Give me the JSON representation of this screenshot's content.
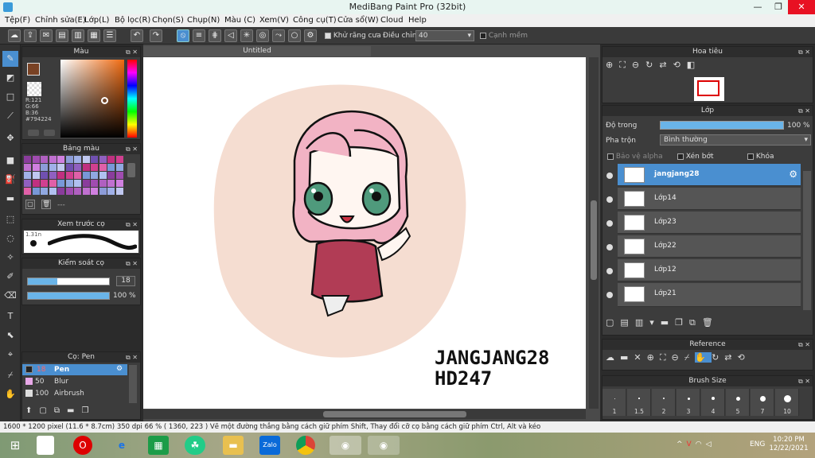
{
  "app": {
    "title": "MediBang Paint Pro (32bit)"
  },
  "menu": [
    "Tệp(F)",
    "Chỉnh sửa(E)",
    "Lớp(L)",
    "Bộ lọc(R)",
    "Chọn(S)",
    "Chụp(N)",
    "Màu (C)",
    "Xem(V)",
    "Công cụ(T)",
    "Cửa sổ(W)",
    "Cloud",
    "Help"
  ],
  "toolbar": {
    "antialias_label": "Khử răng cưa",
    "correction_label": "Điều chỉnh",
    "correction_value": "40",
    "smooth_label": "Cạnh mềm"
  },
  "color_panel": {
    "title": "Màu",
    "r": "R:121",
    "g": "G:66",
    "b": "B:36",
    "hex": "#794224"
  },
  "palette_panel": {
    "title": "Bảng màu",
    "extra": "---"
  },
  "brush_preview": {
    "title": "Xem trước cọ",
    "size": "1.31n"
  },
  "brush_control": {
    "title": "Kiểm soát cọ",
    "size_value": "18",
    "opacity_value": "100 %"
  },
  "brush_list": {
    "title": "Cọ: Pen",
    "items": [
      {
        "size": "18",
        "name": "Pen",
        "selected": true
      },
      {
        "size": "50",
        "name": "Blur",
        "selected": false
      },
      {
        "size": "100",
        "name": "Airbrush",
        "selected": false
      }
    ]
  },
  "document": {
    "tab": "Untitled",
    "signature_line1": "JANGJANG28",
    "signature_line2": "HD247"
  },
  "navigator": {
    "title": "Hoa tiêu"
  },
  "layers": {
    "title": "Lớp",
    "opacity_label": "Độ trong",
    "opacity_value": "100 %",
    "opacity_fraction": 1.0,
    "blend_label": "Pha trộn",
    "blend_value": "Bình thường",
    "protect_alpha": "Bảo vệ alpha",
    "clip": "Xén bớt",
    "lock": "Khóa",
    "items": [
      {
        "name": "jangjang28",
        "selected": true
      },
      {
        "name": "Lớp14",
        "selected": false
      },
      {
        "name": "Lớp23",
        "selected": false
      },
      {
        "name": "Lớp22",
        "selected": false
      },
      {
        "name": "Lớp12",
        "selected": false
      },
      {
        "name": "Lớp21",
        "selected": false
      }
    ]
  },
  "reference": {
    "title": "Reference"
  },
  "brush_size": {
    "title": "Brush Size",
    "sizes": [
      "1",
      "1.5",
      "2",
      "3",
      "4",
      "5",
      "7",
      "10"
    ]
  },
  "status": {
    "text": "1600 * 1200 pixel   (11.6 * 8.7cm)   350 dpi   66 %   ( 1360, 223 )   Vẽ một đường thẳng bằng cách giữ phím Shift, Thay đổi cỡ cọ bằng cách giữ phím Ctrl, Alt và kéo"
  },
  "taskbar": {
    "time": "10:20 PM",
    "date": "12/22/2021",
    "lang": "ENG",
    "zalo": "Zalo"
  },
  "colors": {
    "accent": "#4a8fd0",
    "fg": "#794224",
    "bg": "#ffffff",
    "bg_circle": "#f5ddd1"
  }
}
